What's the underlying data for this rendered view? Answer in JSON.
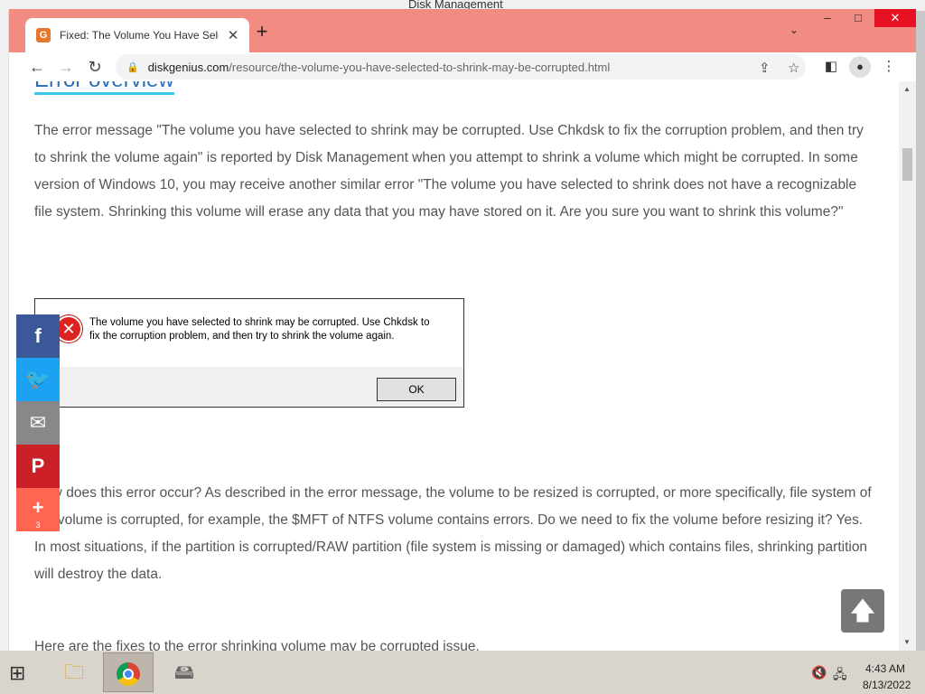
{
  "background_window": {
    "title": "Disk Management"
  },
  "browser": {
    "tab": {
      "title": "Fixed: The Volume You Have Selected to Shrink May Be Corrupted",
      "favicon": "G",
      "close": "✕"
    },
    "new_tab": "+",
    "url": {
      "host": "diskgenius.com",
      "path": "/resource/the-volume-you-have-selected-to-shrink-may-be-corrupted.html"
    },
    "window_controls": {
      "minimize": "–",
      "maximize": "□",
      "close": "✕"
    }
  },
  "page": {
    "heading": "Error overview",
    "para1": "The error message \"The volume you have selected to shrink may be corrupted. Use Chkdsk to fix the corruption problem, and then try to shrink the volume again\" is reported by Disk Management when you attempt to shrink a volume which might be corrupted. In some version of Windows 10, you may receive another similar error \"The volume you have selected to shrink does not have a recognizable file system. Shrinking this volume will erase any data that you may have stored on it. Are you sure you want to shrink this volume?\"",
    "dialog": {
      "message": "The volume you have selected to shrink may be corrupted. Use Chkdsk to fix the corruption problem, and then try to shrink the volume again.",
      "ok_label": "OK"
    },
    "para2": "Why does this error occur? As described in the error message, the volume to be resized is corrupted, or more specifically, file system of the volume is corrupted, for example, the $MFT of NTFS volume contains errors. Do we need to fix the volume before resizing it? Yes. In most situations, if the partition is corrupted/RAW partition (file system is missing or damaged) which contains files, shrinking partition will destroy the data.",
    "para3": "Here are the fixes to the error shrinking volume may be corrupted issue."
  },
  "share_bar": {
    "facebook": "f",
    "twitter": "🐦",
    "email": "✉",
    "pinterest": "P",
    "more": "+",
    "more_count": "3"
  },
  "back_to_top": "🡅",
  "taskbar": {
    "time": "4:43 AM",
    "date": "8/13/2022"
  }
}
